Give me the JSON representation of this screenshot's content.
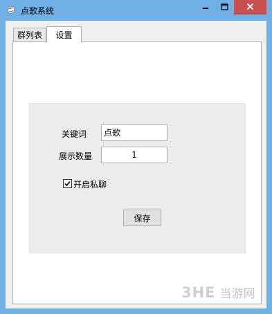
{
  "window": {
    "title": "点歌系统",
    "app_icon": "app-icon",
    "controls": {
      "minimize_icon": "minimize-icon",
      "maximize_icon": "maximize-icon",
      "close_icon": "close-icon",
      "close_color": "#c74f4f",
      "frame_color": "#6fb0e6"
    }
  },
  "tabs": [
    {
      "label": "群列表",
      "selected": false
    },
    {
      "label": "设置",
      "selected": true
    }
  ],
  "settings": {
    "keyword_label": "关键词",
    "keyword_value": "点歌",
    "display_count_label": "展示数量",
    "display_count_value": "1",
    "private_chat_label": "开启私聊",
    "private_chat_checked": true,
    "save_label": "保存"
  },
  "watermark": {
    "logo": "3HE",
    "text": "当游网"
  }
}
